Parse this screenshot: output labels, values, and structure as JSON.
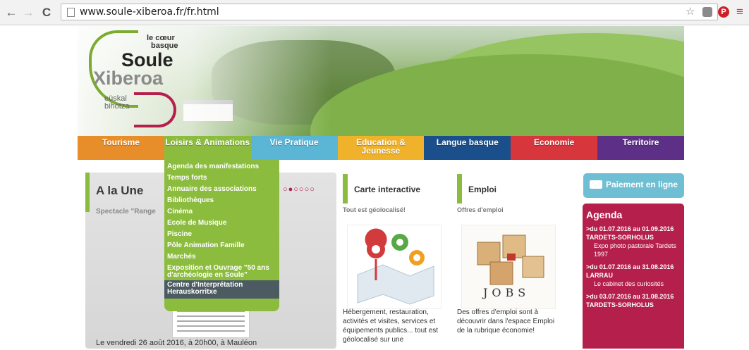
{
  "browser": {
    "url": "www.soule-xiberoa.fr/fr.html",
    "back": "←",
    "forward": "→",
    "reload": "C",
    "star": "☆",
    "menu": "≡"
  },
  "logo": {
    "le_coeur": "le cœur",
    "basque": "basque",
    "soule": "Soule",
    "xiberoa": "Xiberoa",
    "euskal": "eüskal",
    "bihotza": "bihotza"
  },
  "menu": [
    {
      "label": "Tourisme",
      "color": "#e78e2b"
    },
    {
      "label": "Loisirs & Animations",
      "color": "#8cbc3e"
    },
    {
      "label": "Vie Pratique",
      "color": "#5bb6d6"
    },
    {
      "label": "Education & Jeunesse",
      "color": "#f0b22a"
    },
    {
      "label": "Langue basque",
      "color": "#1a4f8b"
    },
    {
      "label": "Economie",
      "color": "#d6363c"
    },
    {
      "label": "Territoire",
      "color": "#5d2f86"
    }
  ],
  "dropdown": [
    "Agenda des manifestations",
    "Temps forts",
    "Annuaire des associations",
    "Bibliothèques",
    "Cinéma",
    "Ecole de Musique",
    "Piscine",
    "Pôle Animation Famille",
    "Marchés",
    "Exposition et Ouvrage \"50 ans d'archéologie en Soule\"",
    "Centre d'Interprétation Herauskorritxe"
  ],
  "une": {
    "title": "A la Une",
    "subtitle": "Spectacle \"Range",
    "dots": "○●○○○○",
    "footer": "Le vendredi 26 août 2016, à 20h00, à Mauléon"
  },
  "carte": {
    "title": "Carte interactive",
    "subtitle": "Tout est géolocalisé!",
    "text": "Hébergement, restauration, activités et visites, services et équipements publics... tout est géolocalisé sur une"
  },
  "emploi": {
    "title": "Emploi",
    "subtitle": "Offres d'emploi",
    "text": "Des offres d'emploi sont à découvrir dans l'espace Emploi de la rubrique économie!",
    "img_word": "JOBS"
  },
  "paiement": "Paiement en ligne",
  "agenda": {
    "title": "Agenda",
    "items": [
      {
        "date": ">du 01.07.2016 au 01.09.2016 TARDETS-SORHOLUS",
        "desc": "Expo photo pastorale Tardets 1997"
      },
      {
        "date": ">du 01.07.2016 au 31.08.2016 LARRAU",
        "desc": "Le cabinet des curiosités"
      },
      {
        "date": ">du 03.07.2016 au 31.08.2016 TARDETS-SORHOLUS",
        "desc": ""
      }
    ]
  }
}
